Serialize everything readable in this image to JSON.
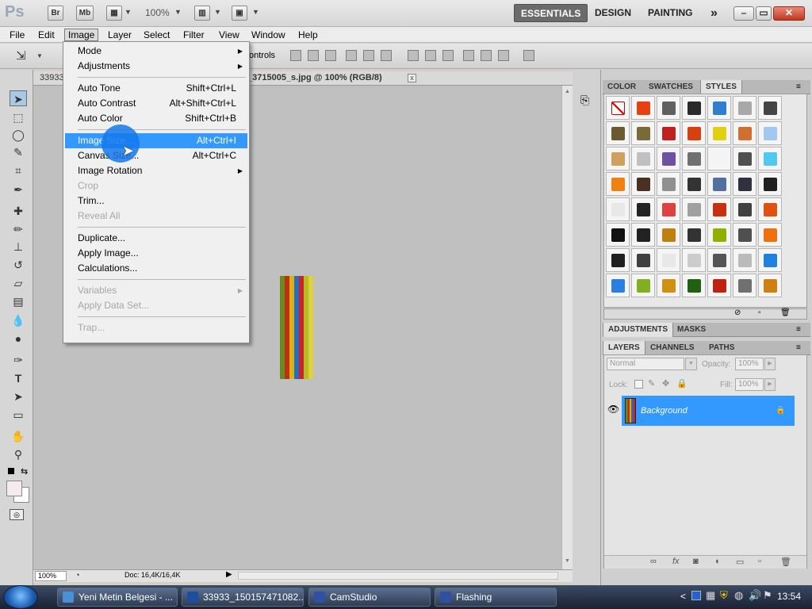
{
  "app": {
    "logo": "Ps",
    "bridge_button": "Br",
    "minibridge_button": "Mb",
    "zoom": "100%",
    "workspaces": [
      "ESSENTIALS",
      "DESIGN",
      "PAINTING"
    ],
    "more_workspaces": "»"
  },
  "menubar": [
    "File",
    "Edit",
    "Image",
    "Layer",
    "Select",
    "Filter",
    "View",
    "Window",
    "Help"
  ],
  "options_bar": {
    "partial_label": "ontrols"
  },
  "document": {
    "tab_left": "33933",
    "tab_title": "_3715005_s.jpg @ 100% (RGB/8)",
    "close": "x",
    "status_zoom": "100%",
    "doc_size": "Doc: 16,4K/16,4K"
  },
  "image_menu": {
    "groups": [
      [
        {
          "label": "Mode",
          "submenu": true
        },
        {
          "label": "Adjustments",
          "submenu": true
        }
      ],
      [
        {
          "label": "Auto Tone",
          "shortcut": "Shift+Ctrl+L"
        },
        {
          "label": "Auto Contrast",
          "shortcut": "Alt+Shift+Ctrl+L"
        },
        {
          "label": "Auto Color",
          "shortcut": "Shift+Ctrl+B"
        }
      ],
      [
        {
          "label": "Image Size...",
          "shortcut": "Alt+Ctrl+I",
          "highlighted": true
        },
        {
          "label": "Canvas Size...",
          "shortcut": "Alt+Ctrl+C"
        },
        {
          "label": "Image Rotation",
          "submenu": true
        },
        {
          "label": "Crop",
          "disabled": true
        },
        {
          "label": "Trim..."
        },
        {
          "label": "Reveal All",
          "disabled": true
        }
      ],
      [
        {
          "label": "Duplicate..."
        },
        {
          "label": "Apply Image..."
        },
        {
          "label": "Calculations..."
        }
      ],
      [
        {
          "label": "Variables",
          "submenu": true,
          "disabled": true
        },
        {
          "label": "Apply Data Set...",
          "disabled": true
        }
      ],
      [
        {
          "label": "Trap...",
          "disabled": true
        }
      ]
    ]
  },
  "panels": {
    "top_tabs": [
      "COLOR",
      "SWATCHES",
      "STYLES"
    ],
    "mid_tabs": [
      "ADJUSTMENTS",
      "MASKS"
    ],
    "layer_tabs": [
      "LAYERS",
      "CHANNELS",
      "PATHS"
    ],
    "blend_mode": "Normal",
    "opacity_label": "Opacity:",
    "opacity_value": "100%",
    "lock_label": "Lock:",
    "fill_label": "Fill:",
    "fill_value": "100%",
    "layer_name": "Background"
  },
  "style_colors": [
    "#ffffff",
    "#e84010",
    "#606060",
    "#2a2a2a",
    "#2f7fd0",
    "#a8a8a8",
    "#444444",
    "#6a5a30",
    "#7a6a3a",
    "#c02020",
    "#d84010",
    "#e0d010",
    "#d07030",
    "#a0c8f0",
    "#d0a060",
    "#c0c0c0",
    "#7050a0",
    "#707070",
    "#f4f4f4",
    "#505050",
    "#50c8f0",
    "#f08010",
    "#4a3020",
    "#909090",
    "#333333",
    "#5070a0",
    "#303040",
    "#202020",
    "#e8e8e8",
    "#222222",
    "#e04040",
    "#a0a0a0",
    "#c83010",
    "#404040",
    "#e05010",
    "#111111",
    "#222222",
    "#c08010",
    "#333333",
    "#90b000",
    "#505050",
    "#f07010",
    "#202020",
    "#404040",
    "#e8e8e8",
    "#cccccc",
    "#555555",
    "#bbbbbb",
    "#2080e0",
    "#2a80e0",
    "#80b020",
    "#d09010",
    "#206010",
    "#c02010",
    "#707070",
    "#d08010"
  ],
  "image_stripes": [
    "#6a8a20",
    "#c03010",
    "#e0b010",
    "#2070c0",
    "#d02030",
    "#b0c020",
    "#e0d040"
  ],
  "taskbar": {
    "tasks": [
      {
        "label": "Yeni Metin Belgesi - ...",
        "color": "#4a90d9"
      },
      {
        "label": "33933_150157471082...",
        "color": "#1c4f9c"
      },
      {
        "label": "CamStudio",
        "color": "#3050a0"
      },
      {
        "label": "Flashing",
        "color": "#3050a0"
      }
    ],
    "tray_chevron": "<",
    "clock": "13:54"
  },
  "colors": {
    "highlight": "#3399ff",
    "cursor": "#1478eb"
  }
}
